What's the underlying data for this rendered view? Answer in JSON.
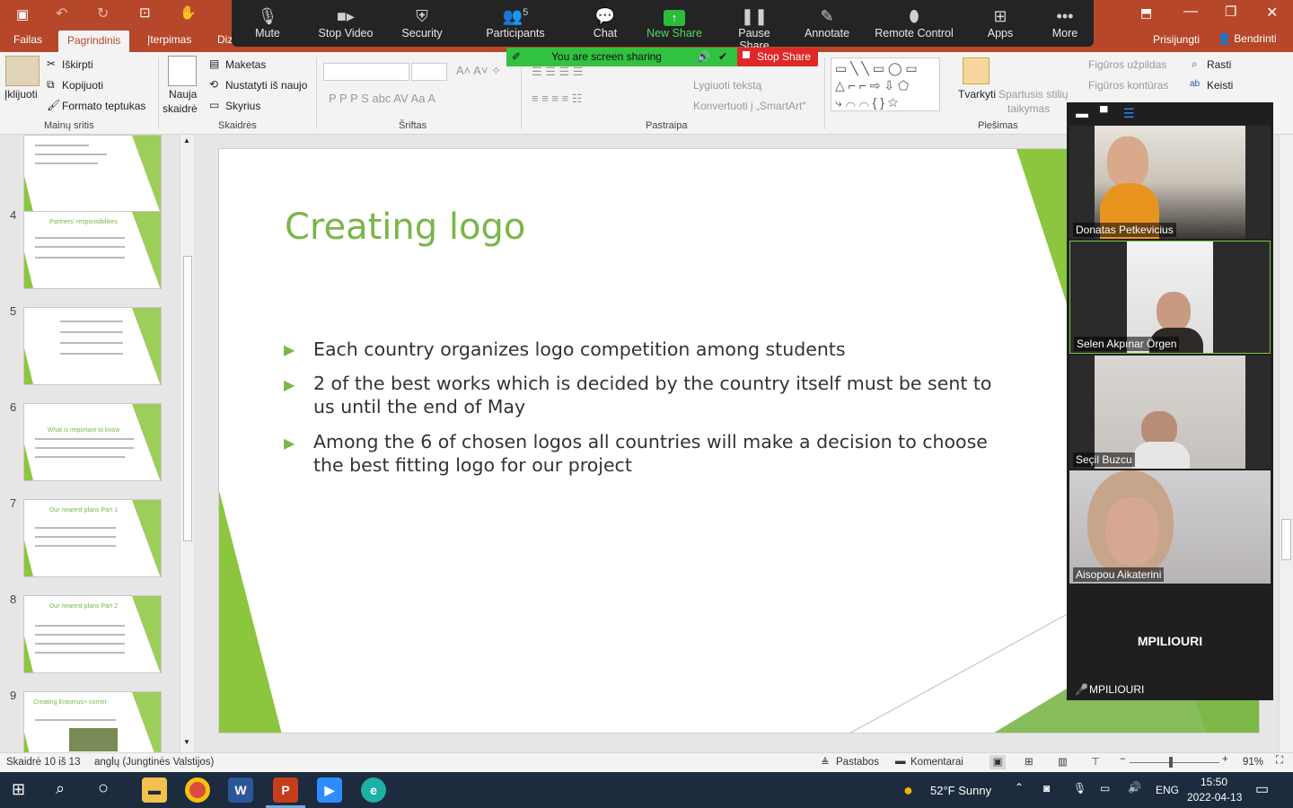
{
  "titlebar": {
    "signin": "Prisijungti",
    "share": "Bendrinti"
  },
  "ribbon_tabs": [
    "Failas",
    "Pagrindinis",
    "Įterpimas",
    "Diz"
  ],
  "ribbon": {
    "paste": "Įklijuoti",
    "cut": "Iškirpti",
    "copy": "Kopijuoti",
    "format_painter": "Formato teptukas",
    "clipboard_group": "Mainų sritis",
    "new_slide": "Nauja",
    "new_slide2": "skaidrė",
    "layout": "Maketas",
    "reset": "Nustatyti iš naujo",
    "section": "Skyrius",
    "slides_group": "Skaidrės",
    "font_group": "Šriftas",
    "paragraph_group": "Pastraipa",
    "align_text": "Lygiuoti tekstą",
    "convert_smartart": "Konvertuoti į „SmartArt\"",
    "shapes": "Tvarkyti",
    "quick_styles": "Spartusis stilių",
    "quick_styles2": "taikymas",
    "drawing_group": "Piešimas",
    "shape_fill": "Figūros užpildas",
    "shape_outline": "Figūros kontūras",
    "find": "Rasti",
    "replace": "Keisti"
  },
  "zoom_toolbar": {
    "mute": "Mute",
    "stop_video": "Stop Video",
    "security": "Security",
    "participants": "Participants",
    "participants_count": "5",
    "chat": "Chat",
    "new_share": "New Share",
    "pause_share": "Pause Share",
    "annotate": "Annotate",
    "remote_control": "Remote Control",
    "apps": "Apps",
    "more": "More",
    "sharing_status": "You are screen sharing",
    "stop_share": "Stop Share"
  },
  "thumbnails": [
    {
      "num": "",
      "title": ""
    },
    {
      "num": "4",
      "title": "Partners' responsibilities"
    },
    {
      "num": "5",
      "title": ""
    },
    {
      "num": "6",
      "title": "What is important to know"
    },
    {
      "num": "7",
      "title": "Our nearest plans Part 1"
    },
    {
      "num": "8",
      "title": "Our nearest plans Part 2"
    },
    {
      "num": "9",
      "title": "Creating Erasmus+ corner"
    }
  ],
  "slide": {
    "title": "Creating logo",
    "bullets": [
      "Each country organizes logo competition among students",
      "2 of the best works which is decided by the country itself must be sent to us until the end of May",
      "Among the 6 of chosen logos all countries will make a decision to choose the best fitting logo for our project"
    ]
  },
  "participants": [
    {
      "name": "Donatas Petkevicius"
    },
    {
      "name": "Selen Akpınar Örgen"
    },
    {
      "name": "Seçil Buzcu"
    },
    {
      "name": "Aisopou Aikaterini"
    },
    {
      "name": "MPILIOURI",
      "label": "MPILIOURI"
    }
  ],
  "statusbar": {
    "slide_info": "Skaidrė 10 iš 13",
    "language": "anglų (Jungtinės Valstijos)",
    "notes": "Pastabos",
    "comments": "Komentarai",
    "zoom": "91%"
  },
  "taskbar": {
    "weather": "52°F  Sunny",
    "lang": "ENG",
    "time": "15:50",
    "date": "2022-04-13"
  },
  "colors": {
    "ppt_red": "#b7472a",
    "accent_green": "#7ab648",
    "zoom_dark": "#242424",
    "share_green": "#31c23f",
    "stop_red": "#e02828"
  }
}
